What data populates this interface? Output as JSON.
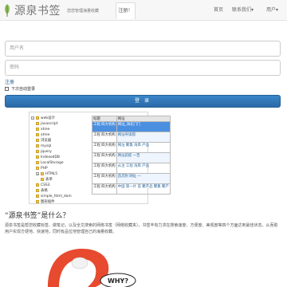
{
  "header": {
    "brand_name": "源泉书签",
    "slogan": "您您管理海量收藏",
    "register_tab": "注册！",
    "nav": {
      "home": "首页",
      "contact": "联系我们▾",
      "user": "用户▾"
    }
  },
  "login": {
    "username_placeholder": "用户名",
    "password_placeholder": "密码",
    "register_link": "注册",
    "remember_label": "下次自动登录",
    "login_button": "登 录"
  },
  "tree": {
    "items": [
      {
        "label": "web设计",
        "level": 0,
        "expander": "−"
      },
      {
        "label": "javascript",
        "level": 1
      },
      {
        "label": "xtree",
        "level": 1
      },
      {
        "label": "xtree",
        "level": 1
      },
      {
        "label": "浏览器",
        "level": 1
      },
      {
        "label": "mysql",
        "level": 1
      },
      {
        "label": "jquery",
        "level": 1
      },
      {
        "label": "IndexedDB",
        "level": 1
      },
      {
        "label": "LocalStorage",
        "level": 1
      },
      {
        "label": "PHP",
        "level": 1
      },
      {
        "label": "HTML5",
        "level": 1,
        "expander": "+"
      },
      {
        "label": "表单",
        "level": 2
      },
      {
        "label": "CSS3",
        "level": 1
      },
      {
        "label": "表格",
        "level": 1
      },
      {
        "label": "simple_html_dom",
        "level": 1
      },
      {
        "label": "图形插件",
        "level": 1
      }
    ]
  },
  "table": {
    "headers": [
      "标题",
      "网址"
    ],
    "rows": [
      {
        "title": "工程 四大机构",
        "url": "网址_海北门门"
      },
      {
        "title": "工程 四大机构",
        "url": "网址导读圆"
      },
      {
        "title": "工程 四大机构",
        "url": "网址 聚集 海库 产品"
      },
      {
        "title": "工程 四大机构",
        "url": "网址前提 一百"
      },
      {
        "title": "工程 四大机构",
        "url": "从注 工程 海库 产品"
      },
      {
        "title": "工程 四大机构",
        "url": "首次附 网址 一"
      },
      {
        "title": "工程 四大机构",
        "url": "中国 第一片 首 聚产品 聚集 聚产"
      }
    ]
  },
  "about": {
    "heading": "“源泉书签”是什么？",
    "description": "源泉书签是帮您收藏标签、做笔记，以及全文搜索的网络书签（网络收藏夹）。书签丰有力求在搜索速度、方便度、美观度等四个方面达到最佳状态，从而助用户实现方便地、快速地，同时有品位地管理自己的海量收藏。"
  },
  "mascot": {
    "bubble_text": "WHY?"
  }
}
